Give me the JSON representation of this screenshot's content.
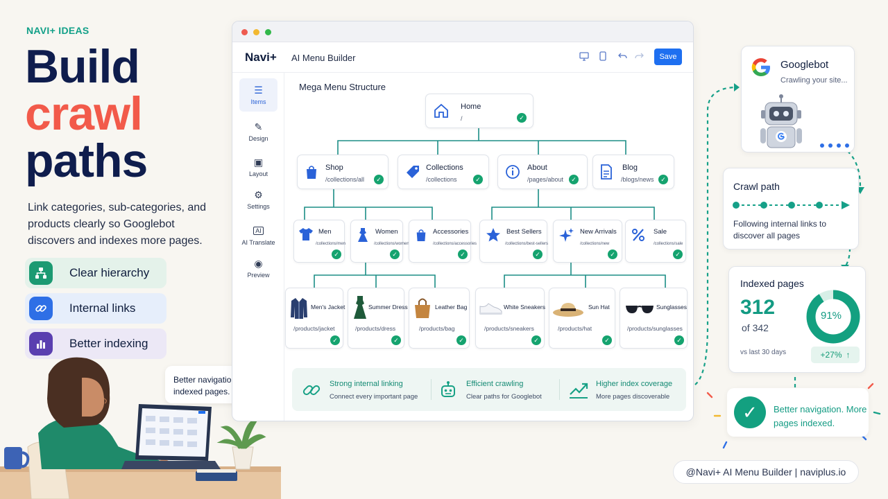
{
  "hero": {
    "eyebrow": "NAVI+ IDEAS",
    "line1": "Build",
    "line2": "crawl",
    "line3": "paths",
    "lead": "Link categories, sub-categories, and products clearly so Googlebot discovers and indexes more pages.",
    "chips": [
      {
        "label": "Clear hierarchy",
        "icon": "hierarchy-icon"
      },
      {
        "label": "Internal links",
        "icon": "link-icon"
      },
      {
        "label": "Better indexing",
        "icon": "bar-chart-icon"
      }
    ]
  },
  "illustration": {
    "bubble_text": "Better navigation. More indexed pages."
  },
  "app": {
    "brand": "Navi+",
    "title": "AI Menu Builder",
    "save_label": "Save",
    "canvas_title": "Mega Menu Structure",
    "sidebar": [
      {
        "label": "Items",
        "icon": "list-icon",
        "active": true
      },
      {
        "label": "Design",
        "icon": "pencil-icon",
        "active": false
      },
      {
        "label": "Layout",
        "icon": "layout-icon",
        "active": false
      },
      {
        "label": "Settings",
        "icon": "gear-icon",
        "active": false
      },
      {
        "label": "AI Translate",
        "icon": "ai-icon",
        "active": false
      },
      {
        "label": "Preview",
        "icon": "eye-icon",
        "active": false
      }
    ],
    "home": {
      "title": "Home",
      "path": "/"
    },
    "level1": [
      {
        "title": "Shop",
        "path": "/collections/all",
        "icon": "bag-icon"
      },
      {
        "title": "Collections",
        "path": "/collections",
        "icon": "tag-icon"
      },
      {
        "title": "About",
        "path": "/pages/about",
        "icon": "info-icon"
      },
      {
        "title": "Blog",
        "path": "/blogs/news",
        "icon": "document-icon"
      }
    ],
    "level2": [
      {
        "title": "Men",
        "path": "/collections/men",
        "icon": "shirt-icon"
      },
      {
        "title": "Women",
        "path": "/collections/women",
        "icon": "dress-icon"
      },
      {
        "title": "Accessories",
        "path": "/collections/accessories",
        "icon": "bag-icon"
      },
      {
        "title": "Best Sellers",
        "path": "/collections/best-sellers",
        "icon": "star-icon"
      },
      {
        "title": "New Arrivals",
        "path": "/collections/new",
        "icon": "sparkle-icon"
      },
      {
        "title": "Sale",
        "path": "/collections/sale",
        "icon": "percent-icon"
      }
    ],
    "level3": [
      {
        "title": "Men's Jacket",
        "path": "/products/jacket",
        "icon": "jacket-icon"
      },
      {
        "title": "Summer Dress",
        "path": "/products/dress",
        "icon": "dress-icon"
      },
      {
        "title": "Leather Bag",
        "path": "/products/bag",
        "icon": "handbag-icon"
      },
      {
        "title": "White Sneakers",
        "path": "/products/sneakers",
        "icon": "sneaker-icon"
      },
      {
        "title": "Sun Hat",
        "path": "/products/hat",
        "icon": "hat-icon"
      },
      {
        "title": "Sunglasses",
        "path": "/products/sunglasses",
        "icon": "sunglasses-icon"
      }
    ],
    "benefits": [
      {
        "title": "Strong internal linking",
        "sub": "Connect every important page",
        "icon": "link-icon"
      },
      {
        "title": "Efficient crawling",
        "sub": "Clear paths for Googlebot",
        "icon": "robot-icon"
      },
      {
        "title": "Higher index coverage",
        "sub": "More pages discoverable",
        "icon": "trend-icon"
      }
    ]
  },
  "googlebot": {
    "title": "Googlebot",
    "sub": "Crawling your site..."
  },
  "crawl": {
    "title": "Crawl path",
    "text": "Following internal links to discover all pages"
  },
  "indexed": {
    "title": "Indexed pages",
    "count": "312",
    "of": "of 342",
    "percent_label": "91%",
    "percent": 0.91,
    "vs": "vs last 30 days",
    "delta": "+27%"
  },
  "result": {
    "text": "Better navigation. More pages indexed."
  },
  "footer": {
    "text": "@Navi+ AI Menu Builder | naviplus.io"
  },
  "colors": {
    "teal": "#13a080",
    "coral": "#f25a4a",
    "navy": "#0f1d4d",
    "blue": "#1e6ff0"
  }
}
